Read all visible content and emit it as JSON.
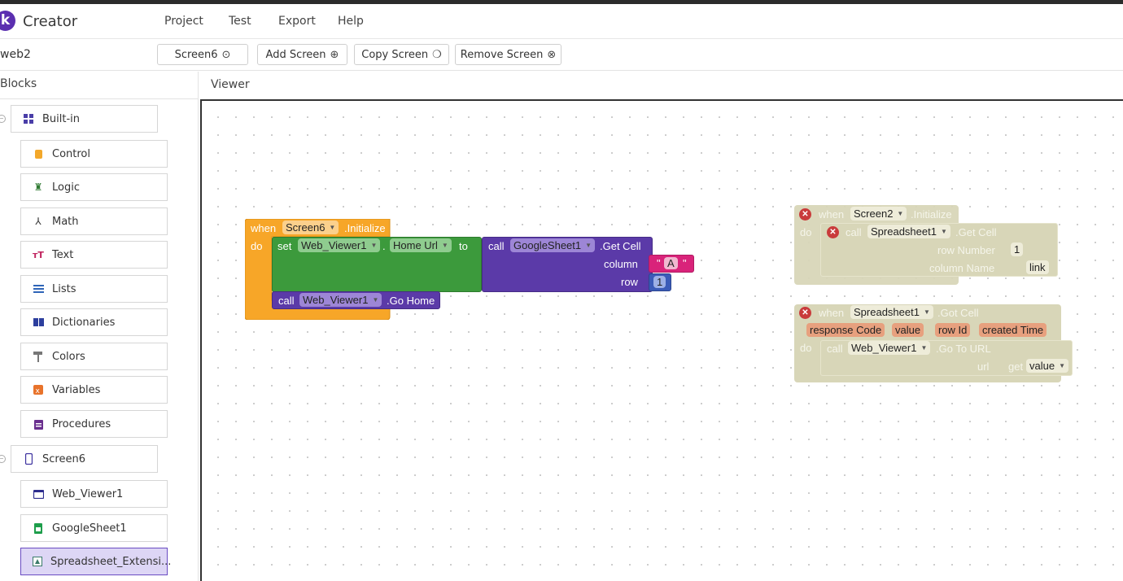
{
  "app": {
    "logo_letter": "k",
    "title": "Creator"
  },
  "menu": [
    "Project",
    "Test",
    "Export",
    "Help"
  ],
  "toolbar": {
    "project": "web2",
    "screen_select": "Screen6",
    "add_screen": "Add Screen",
    "copy_screen": "Copy Screen",
    "remove_screen": "Remove Screen"
  },
  "blocks_panel": {
    "title": "Blocks",
    "builtin": {
      "label": "Built-in",
      "items": [
        "Control",
        "Logic",
        "Math",
        "Text",
        "Lists",
        "Dictionaries",
        "Colors",
        "Variables",
        "Procedures"
      ]
    },
    "screen": {
      "label": "Screen6",
      "items": [
        "Web_Viewer1",
        "GoogleSheet1",
        "Spreadsheet_Extensi..."
      ]
    }
  },
  "viewer": {
    "title": "Viewer"
  },
  "colors": {
    "control": "#f7a628",
    "setter": "#3c9a3c",
    "component": "#5b3aa8",
    "text": "#d9237a",
    "math": "#3b5bb8",
    "disabled": "#d8d6b8",
    "accent": "#5b2fb0"
  },
  "block1": {
    "when": "when",
    "screen": "Screen6",
    "event": ".Initialize",
    "do": "do",
    "set": "set",
    "viewer": "Web_Viewer1",
    "dot": ".",
    "property": "Home Url",
    "to": "to",
    "call": "call",
    "sheet": "GoogleSheet1",
    "method": ".Get Cell",
    "column_label": "column",
    "column_value": "A",
    "row_label": "row",
    "row_value": "1",
    "call2": "call",
    "viewer2": "Web_Viewer1",
    "method2": ".Go Home"
  },
  "block2": {
    "when": "when",
    "screen": "Screen2",
    "event": ".Initialize",
    "do": "do",
    "call": "call",
    "component": "Spreadsheet1",
    "method": ".Get Cell",
    "row_label": "row Number",
    "row_value": "1",
    "column_label": "column Name",
    "column_value": "link"
  },
  "block3": {
    "when": "when",
    "component": "Spreadsheet1",
    "event": ".Got Cell",
    "params": [
      "response Code",
      "value",
      "row Id",
      "created Time"
    ],
    "do": "do",
    "call": "call",
    "viewer": "Web_Viewer1",
    "method": ".Go To URL",
    "url_label": "url",
    "get": "get",
    "get_value": "value"
  }
}
